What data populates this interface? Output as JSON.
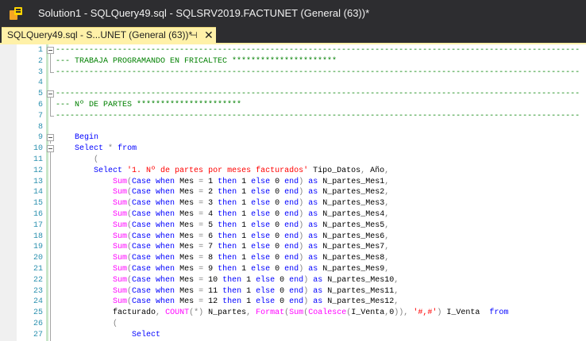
{
  "window": {
    "title": "Solution1 - SQLQuery49.sql - SQLSRV2019.FACTUNET (General (63))*"
  },
  "tab": {
    "label": "SQLQuery49.sql - S...UNET (General (63))*",
    "pin_glyph": "⊣",
    "close_glyph": "✕"
  },
  "icons": {
    "app": "ssms-logo-icon",
    "pin": "pin-icon",
    "close": "close-icon"
  },
  "colors": {
    "titlebar": "#2d2d30",
    "tab_active": "#fff1a8",
    "comment": "#008000",
    "keyword": "#0000ff",
    "function": "#ff00ff",
    "string": "#ff0000",
    "operator": "#808080",
    "line_number": "#2b91af"
  },
  "editor": {
    "lines": [
      {
        "n": "1",
        "fold": "box",
        "tokens": [
          [
            "c",
            "--------------------------------------------------------------------------------------------------------------"
          ]
        ]
      },
      {
        "n": "2",
        "fold": "line",
        "tokens": [
          [
            "c",
            "--- TRABAJA PROGRAMANDO EN FRICALTEC **********************"
          ]
        ]
      },
      {
        "n": "3",
        "fold": "end",
        "tokens": [
          [
            "c",
            "--------------------------------------------------------------------------------------------------------------"
          ]
        ]
      },
      {
        "n": "4",
        "fold": "",
        "tokens": []
      },
      {
        "n": "5",
        "fold": "box",
        "tokens": [
          [
            "c",
            "--------------------------------------------------------------------------------------------------------------"
          ]
        ]
      },
      {
        "n": "6",
        "fold": "line",
        "tokens": [
          [
            "c",
            "--- Nº DE PARTES **********************"
          ]
        ]
      },
      {
        "n": "7",
        "fold": "end",
        "tokens": [
          [
            "c",
            "--------------------------------------------------------------------------------------------------------------"
          ]
        ]
      },
      {
        "n": "8",
        "fold": "",
        "tokens": []
      },
      {
        "n": "9",
        "fold": "box",
        "tokens": [
          [
            "p",
            "    "
          ],
          [
            "k",
            "Begin"
          ]
        ]
      },
      {
        "n": "10",
        "fold": "box",
        "tokens": [
          [
            "p",
            "    "
          ],
          [
            "k",
            "Select"
          ],
          [
            "p",
            " "
          ],
          [
            "g",
            "*"
          ],
          [
            "p",
            " "
          ],
          [
            "k",
            "from"
          ]
        ]
      },
      {
        "n": "11",
        "fold": "line",
        "tokens": [
          [
            "p",
            "        "
          ],
          [
            "g",
            "("
          ]
        ]
      },
      {
        "n": "12",
        "fold": "line",
        "tokens": [
          [
            "p",
            "        "
          ],
          [
            "k",
            "Select"
          ],
          [
            "p",
            " "
          ],
          [
            "s",
            "'1. Nº de partes por meses facturados'"
          ],
          [
            "p",
            " Tipo_Datos"
          ],
          [
            "g",
            ","
          ],
          [
            "p",
            " Año"
          ],
          [
            "g",
            ","
          ]
        ]
      },
      {
        "n": "13",
        "fold": "line",
        "tokens": [
          [
            "p",
            "            "
          ],
          [
            "f",
            "Sum"
          ],
          [
            "g",
            "("
          ],
          [
            "k",
            "Case when"
          ],
          [
            "p",
            " Mes "
          ],
          [
            "g",
            "="
          ],
          [
            "p",
            " 1 "
          ],
          [
            "k",
            "then"
          ],
          [
            "p",
            " 1 "
          ],
          [
            "k",
            "else"
          ],
          [
            "p",
            " 0 "
          ],
          [
            "k",
            "end"
          ],
          [
            "g",
            ")"
          ],
          [
            "p",
            " "
          ],
          [
            "k",
            "as"
          ],
          [
            "p",
            " N_partes_Mes1"
          ],
          [
            "g",
            ","
          ]
        ]
      },
      {
        "n": "14",
        "fold": "line",
        "tokens": [
          [
            "p",
            "            "
          ],
          [
            "f",
            "Sum"
          ],
          [
            "g",
            "("
          ],
          [
            "k",
            "Case when"
          ],
          [
            "p",
            " Mes "
          ],
          [
            "g",
            "="
          ],
          [
            "p",
            " 2 "
          ],
          [
            "k",
            "then"
          ],
          [
            "p",
            " 1 "
          ],
          [
            "k",
            "else"
          ],
          [
            "p",
            " 0 "
          ],
          [
            "k",
            "end"
          ],
          [
            "g",
            ")"
          ],
          [
            "p",
            " "
          ],
          [
            "k",
            "as"
          ],
          [
            "p",
            " N_partes_Mes2"
          ],
          [
            "g",
            ","
          ]
        ]
      },
      {
        "n": "15",
        "fold": "line",
        "tokens": [
          [
            "p",
            "            "
          ],
          [
            "f",
            "Sum"
          ],
          [
            "g",
            "("
          ],
          [
            "k",
            "Case when"
          ],
          [
            "p",
            " Mes "
          ],
          [
            "g",
            "="
          ],
          [
            "p",
            " 3 "
          ],
          [
            "k",
            "then"
          ],
          [
            "p",
            " 1 "
          ],
          [
            "k",
            "else"
          ],
          [
            "p",
            " 0 "
          ],
          [
            "k",
            "end"
          ],
          [
            "g",
            ")"
          ],
          [
            "p",
            " "
          ],
          [
            "k",
            "as"
          ],
          [
            "p",
            " N_partes_Mes3"
          ],
          [
            "g",
            ","
          ]
        ]
      },
      {
        "n": "16",
        "fold": "line",
        "tokens": [
          [
            "p",
            "            "
          ],
          [
            "f",
            "Sum"
          ],
          [
            "g",
            "("
          ],
          [
            "k",
            "Case when"
          ],
          [
            "p",
            " Mes "
          ],
          [
            "g",
            "="
          ],
          [
            "p",
            " 4 "
          ],
          [
            "k",
            "then"
          ],
          [
            "p",
            " 1 "
          ],
          [
            "k",
            "else"
          ],
          [
            "p",
            " 0 "
          ],
          [
            "k",
            "end"
          ],
          [
            "g",
            ")"
          ],
          [
            "p",
            " "
          ],
          [
            "k",
            "as"
          ],
          [
            "p",
            " N_partes_Mes4"
          ],
          [
            "g",
            ","
          ]
        ]
      },
      {
        "n": "17",
        "fold": "line",
        "tokens": [
          [
            "p",
            "            "
          ],
          [
            "f",
            "Sum"
          ],
          [
            "g",
            "("
          ],
          [
            "k",
            "Case when"
          ],
          [
            "p",
            " Mes "
          ],
          [
            "g",
            "="
          ],
          [
            "p",
            " 5 "
          ],
          [
            "k",
            "then"
          ],
          [
            "p",
            " 1 "
          ],
          [
            "k",
            "else"
          ],
          [
            "p",
            " 0 "
          ],
          [
            "k",
            "end"
          ],
          [
            "g",
            ")"
          ],
          [
            "p",
            " "
          ],
          [
            "k",
            "as"
          ],
          [
            "p",
            " N_partes_Mes5"
          ],
          [
            "g",
            ","
          ]
        ]
      },
      {
        "n": "18",
        "fold": "line",
        "tokens": [
          [
            "p",
            "            "
          ],
          [
            "f",
            "Sum"
          ],
          [
            "g",
            "("
          ],
          [
            "k",
            "Case when"
          ],
          [
            "p",
            " Mes "
          ],
          [
            "g",
            "="
          ],
          [
            "p",
            " 6 "
          ],
          [
            "k",
            "then"
          ],
          [
            "p",
            " 1 "
          ],
          [
            "k",
            "else"
          ],
          [
            "p",
            " 0 "
          ],
          [
            "k",
            "end"
          ],
          [
            "g",
            ")"
          ],
          [
            "p",
            " "
          ],
          [
            "k",
            "as"
          ],
          [
            "p",
            " N_partes_Mes6"
          ],
          [
            "g",
            ","
          ]
        ]
      },
      {
        "n": "19",
        "fold": "line",
        "tokens": [
          [
            "p",
            "            "
          ],
          [
            "f",
            "Sum"
          ],
          [
            "g",
            "("
          ],
          [
            "k",
            "Case when"
          ],
          [
            "p",
            " Mes "
          ],
          [
            "g",
            "="
          ],
          [
            "p",
            " 7 "
          ],
          [
            "k",
            "then"
          ],
          [
            "p",
            " 1 "
          ],
          [
            "k",
            "else"
          ],
          [
            "p",
            " 0 "
          ],
          [
            "k",
            "end"
          ],
          [
            "g",
            ")"
          ],
          [
            "p",
            " "
          ],
          [
            "k",
            "as"
          ],
          [
            "p",
            " N_partes_Mes7"
          ],
          [
            "g",
            ","
          ]
        ]
      },
      {
        "n": "20",
        "fold": "line",
        "tokens": [
          [
            "p",
            "            "
          ],
          [
            "f",
            "Sum"
          ],
          [
            "g",
            "("
          ],
          [
            "k",
            "Case when"
          ],
          [
            "p",
            " Mes "
          ],
          [
            "g",
            "="
          ],
          [
            "p",
            " 8 "
          ],
          [
            "k",
            "then"
          ],
          [
            "p",
            " 1 "
          ],
          [
            "k",
            "else"
          ],
          [
            "p",
            " 0 "
          ],
          [
            "k",
            "end"
          ],
          [
            "g",
            ")"
          ],
          [
            "p",
            " "
          ],
          [
            "k",
            "as"
          ],
          [
            "p",
            " N_partes_Mes8"
          ],
          [
            "g",
            ","
          ]
        ]
      },
      {
        "n": "21",
        "fold": "line",
        "tokens": [
          [
            "p",
            "            "
          ],
          [
            "f",
            "Sum"
          ],
          [
            "g",
            "("
          ],
          [
            "k",
            "Case when"
          ],
          [
            "p",
            " Mes "
          ],
          [
            "g",
            "="
          ],
          [
            "p",
            " 9 "
          ],
          [
            "k",
            "then"
          ],
          [
            "p",
            " 1 "
          ],
          [
            "k",
            "else"
          ],
          [
            "p",
            " 0 "
          ],
          [
            "k",
            "end"
          ],
          [
            "g",
            ")"
          ],
          [
            "p",
            " "
          ],
          [
            "k",
            "as"
          ],
          [
            "p",
            " N_partes_Mes9"
          ],
          [
            "g",
            ","
          ]
        ]
      },
      {
        "n": "22",
        "fold": "line",
        "tokens": [
          [
            "p",
            "            "
          ],
          [
            "f",
            "Sum"
          ],
          [
            "g",
            "("
          ],
          [
            "k",
            "Case when"
          ],
          [
            "p",
            " Mes "
          ],
          [
            "g",
            "="
          ],
          [
            "p",
            " 10 "
          ],
          [
            "k",
            "then"
          ],
          [
            "p",
            " 1 "
          ],
          [
            "k",
            "else"
          ],
          [
            "p",
            " 0 "
          ],
          [
            "k",
            "end"
          ],
          [
            "g",
            ")"
          ],
          [
            "p",
            " "
          ],
          [
            "k",
            "as"
          ],
          [
            "p",
            " N_partes_Mes10"
          ],
          [
            "g",
            ","
          ]
        ]
      },
      {
        "n": "23",
        "fold": "line",
        "tokens": [
          [
            "p",
            "            "
          ],
          [
            "f",
            "Sum"
          ],
          [
            "g",
            "("
          ],
          [
            "k",
            "Case when"
          ],
          [
            "p",
            " Mes "
          ],
          [
            "g",
            "="
          ],
          [
            "p",
            " 11 "
          ],
          [
            "k",
            "then"
          ],
          [
            "p",
            " 1 "
          ],
          [
            "k",
            "else"
          ],
          [
            "p",
            " 0 "
          ],
          [
            "k",
            "end"
          ],
          [
            "g",
            ")"
          ],
          [
            "p",
            " "
          ],
          [
            "k",
            "as"
          ],
          [
            "p",
            " N_partes_Mes11"
          ],
          [
            "g",
            ","
          ]
        ]
      },
      {
        "n": "24",
        "fold": "line",
        "tokens": [
          [
            "p",
            "            "
          ],
          [
            "f",
            "Sum"
          ],
          [
            "g",
            "("
          ],
          [
            "k",
            "Case when"
          ],
          [
            "p",
            " Mes "
          ],
          [
            "g",
            "="
          ],
          [
            "p",
            " 12 "
          ],
          [
            "k",
            "then"
          ],
          [
            "p",
            " 1 "
          ],
          [
            "k",
            "else"
          ],
          [
            "p",
            " 0 "
          ],
          [
            "k",
            "end"
          ],
          [
            "g",
            ")"
          ],
          [
            "p",
            " "
          ],
          [
            "k",
            "as"
          ],
          [
            "p",
            " N_partes_Mes12"
          ],
          [
            "g",
            ","
          ]
        ]
      },
      {
        "n": "25",
        "fold": "line",
        "tokens": [
          [
            "p",
            "            facturado"
          ],
          [
            "g",
            ","
          ],
          [
            "p",
            " "
          ],
          [
            "f",
            "COUNT"
          ],
          [
            "g",
            "(*)"
          ],
          [
            "p",
            " N_partes"
          ],
          [
            "g",
            ","
          ],
          [
            "p",
            " "
          ],
          [
            "f",
            "Format"
          ],
          [
            "g",
            "("
          ],
          [
            "f",
            "Sum"
          ],
          [
            "g",
            "("
          ],
          [
            "f",
            "Coalesce"
          ],
          [
            "g",
            "("
          ],
          [
            "p",
            "I_Venta"
          ],
          [
            "g",
            ","
          ],
          [
            "p",
            "0"
          ],
          [
            "g",
            "))"
          ],
          [
            "g",
            ","
          ],
          [
            "p",
            " "
          ],
          [
            "s",
            "'#,#'"
          ],
          [
            "g",
            ")"
          ],
          [
            "p",
            " I_Venta  "
          ],
          [
            "k",
            "from"
          ]
        ]
      },
      {
        "n": "26",
        "fold": "line",
        "tokens": [
          [
            "p",
            "            "
          ],
          [
            "g",
            "("
          ]
        ]
      },
      {
        "n": "27",
        "fold": "line",
        "tokens": [
          [
            "p",
            "                "
          ],
          [
            "k",
            "Select"
          ]
        ]
      }
    ]
  }
}
